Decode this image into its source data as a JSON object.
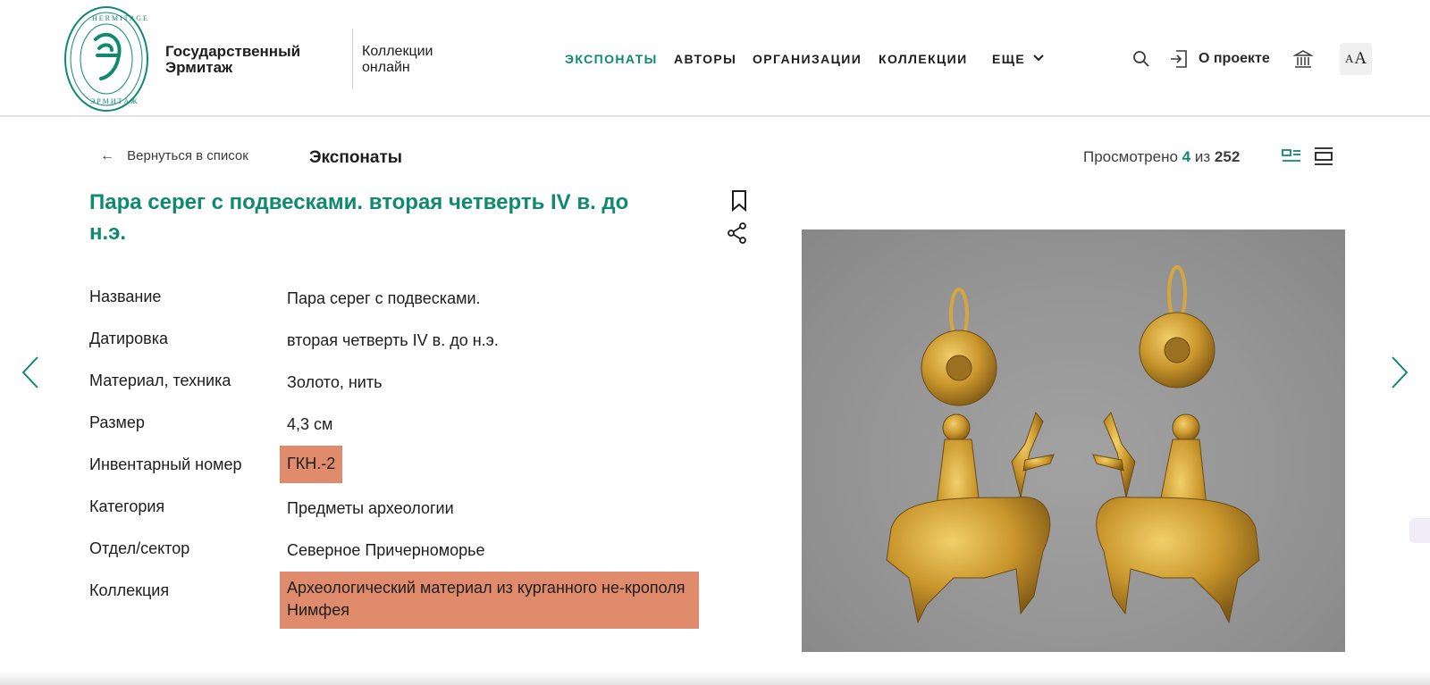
{
  "brand": {
    "logo_name": "hermitage-logo",
    "org_name_line1": "Государственный",
    "org_name_line2": "Эрмитаж",
    "subtitle_line1": "Коллекции",
    "subtitle_line2": "онлайн"
  },
  "nav": {
    "items": [
      {
        "label": "ЭКСПОНАТЫ",
        "active": true
      },
      {
        "label": "АВТОРЫ",
        "active": false
      },
      {
        "label": "ОРГАНИЗАЦИИ",
        "active": false
      },
      {
        "label": "КОЛЛЕКЦИИ",
        "active": false
      },
      {
        "label": "ЕЩЕ",
        "active": false
      }
    ],
    "more_icon": "chevron-down-icon"
  },
  "header_actions": {
    "search_icon": "search-icon",
    "about_icon": "login-icon",
    "about_label": "О проекте",
    "museum_icon": "museum-icon",
    "font_size_small": "A",
    "font_size_big": "A"
  },
  "subheader": {
    "back_label": "Вернуться в список",
    "back_arrow": "←",
    "section_title": "Экспонаты",
    "viewed_prefix": "Просмотрено",
    "viewed_current": "4",
    "viewed_of": "из",
    "viewed_total": "252"
  },
  "item": {
    "title": "Пара серег с подвесками. вторая четверть IV в. до н.э.",
    "details": [
      {
        "label": "Название",
        "value": "Пара серег с подвесками.",
        "highlight": false
      },
      {
        "label": "Датировка",
        "value": "вторая четверть IV в. до н.э.",
        "highlight": false
      },
      {
        "label": "Материал, техника",
        "value": "Золото, нить",
        "highlight": false
      },
      {
        "label": "Размер",
        "value": "4,3 см",
        "highlight": false
      },
      {
        "label": "Инвентарный номер",
        "value": "ГКН.-2",
        "highlight": true
      },
      {
        "label": "Категория",
        "value": "Предметы археологии",
        "highlight": false
      },
      {
        "label": "Отдел/сектор",
        "value": "Северное Причерноморье",
        "highlight": false
      },
      {
        "label": "Коллекция",
        "value": "Археологический материал из курганного не-крополя Нимфея",
        "highlight": true
      }
    ]
  },
  "colors": {
    "accent": "#0f8a6f",
    "highlight": "#e08b6b",
    "photo_bg": "#959595",
    "gold": "#c99a2e"
  }
}
